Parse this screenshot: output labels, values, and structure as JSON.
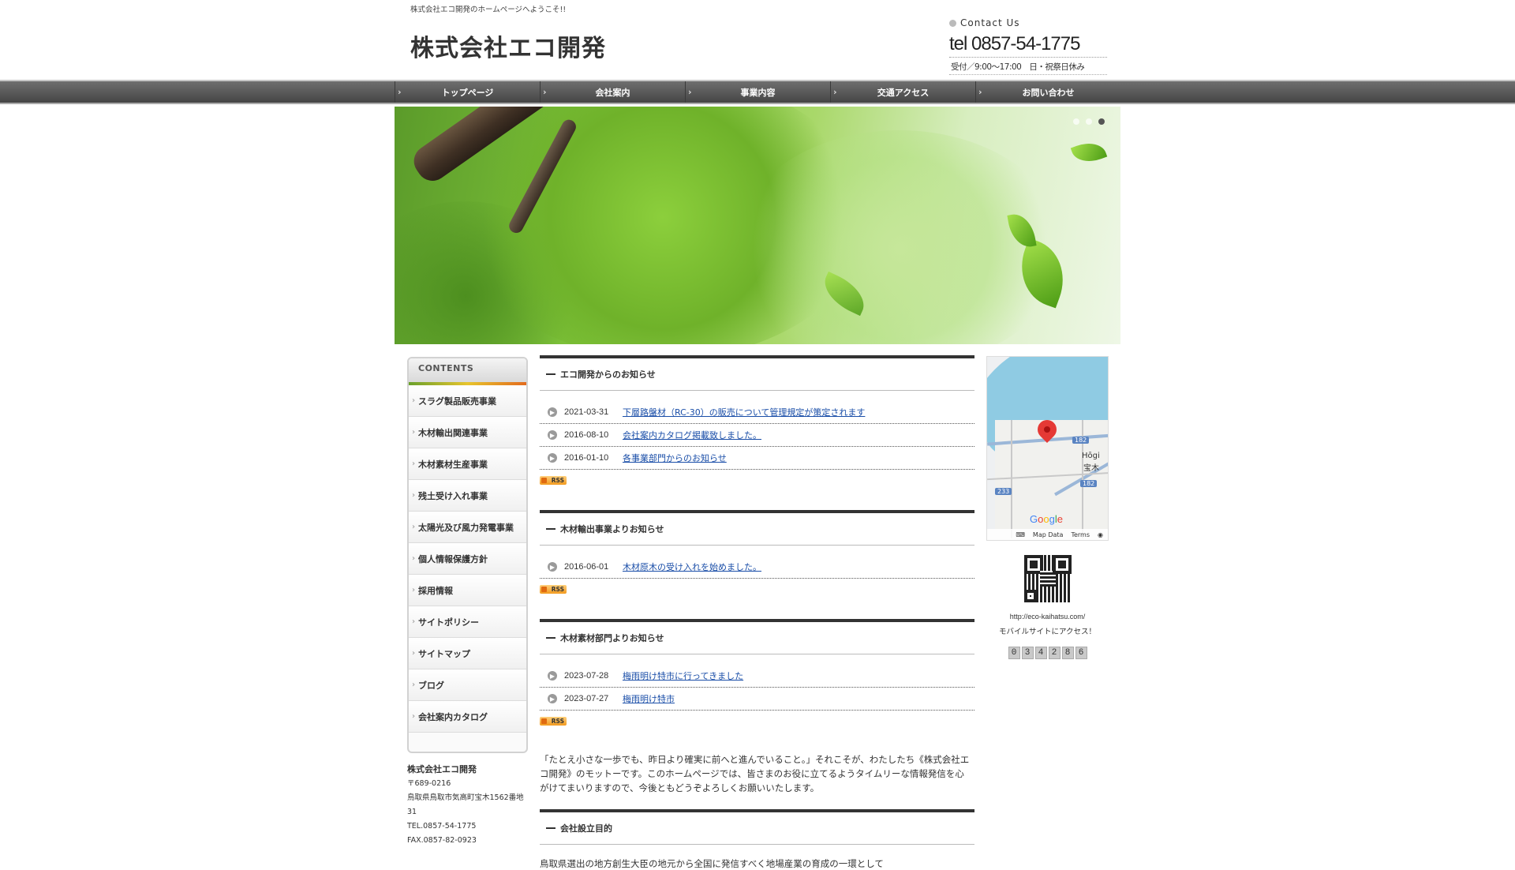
{
  "header": {
    "welcome": "株式会社エコ開発のホームページへようこそ!!",
    "site_title": "株式会社エコ開発",
    "contact_label": "Contact Us",
    "tel": "tel 0857-54-1775",
    "hours": "受付／9:00～17:00　日・祝祭日休み"
  },
  "nav": {
    "items": [
      "トップページ",
      "会社案内",
      "事業内容",
      "交通アクセス",
      "お問い合わせ"
    ]
  },
  "sidebar": {
    "contents_title": "CONTENTS",
    "items": [
      "スラグ製品販売事業",
      "木材輸出関連事業",
      "木材素材生産事業",
      "残土受け入れ事業",
      "太陽光及び風力発電事業",
      "個人情報保護方針",
      "採用情報",
      "サイトポリシー",
      "サイトマップ",
      "ブログ",
      "会社案内カタログ"
    ],
    "company": {
      "name": "株式会社エコ開発",
      "zip": "〒689-0216",
      "address1": "鳥取県鳥取市気高町宝木1562番地",
      "address2": "31",
      "tel": "TEL.0857-54-1775",
      "fax": "FAX.0857-82-0923"
    }
  },
  "main": {
    "sections": [
      {
        "title": "エコ開発からのお知らせ",
        "news": [
          {
            "date": "2021-03-31",
            "title": "下層路盤材（RC-30）の販売について管理規定が策定されます"
          },
          {
            "date": "2016-08-10",
            "title": "会社案内カタログ掲載致しました。"
          },
          {
            "date": "2016-01-10",
            "title": "各事業部門からのお知らせ"
          }
        ]
      },
      {
        "title": "木材輸出事業よりお知らせ",
        "news": [
          {
            "date": "2016-06-01",
            "title": "木材原木の受け入れを始めました。"
          }
        ]
      },
      {
        "title": "木材素材部門よりお知らせ",
        "news": [
          {
            "date": "2023-07-28",
            "title": "梅雨明け特市に行ってきました"
          },
          {
            "date": "2023-07-27",
            "title": "梅雨明け特市"
          }
        ]
      }
    ],
    "rss_label": "RSS",
    "motto": "「たとえ小さな一歩でも、昨日より確実に前へと進んでいること。」それこそが、わたしたち《株式会社エコ開発》のモットーです。このホームページでは、皆さまのお役に立てるようタイムリーな情報発信を心がけてまいりますので、今後ともどうぞよろしくお願いいたします。",
    "establish_title": "会社設立目的",
    "establish_text": "鳥取県選出の地方創生大臣の地元から全国に発信すべく地場産業の育成の一環として"
  },
  "right": {
    "map": {
      "place_en": "Hōgi",
      "place_jp": "宝木",
      "route_182": "182",
      "route_233": "233",
      "google": "Google",
      "map_data": "Map Data",
      "terms": "Terms"
    },
    "mobile_url": "http://eco-kaihatsu.com/",
    "mobile_text": "モバイルサイトにアクセス！",
    "counter": [
      "0",
      "3",
      "4",
      "2",
      "8",
      "6"
    ]
  }
}
